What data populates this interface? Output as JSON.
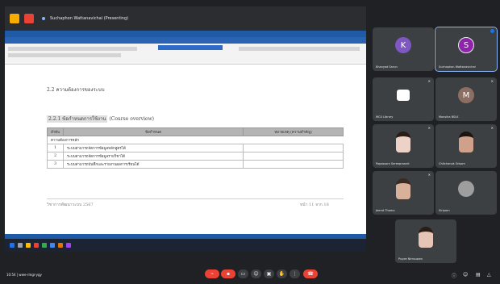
{
  "share": {
    "title_bar": "Suchaphon Wattanavichai (Presenting)",
    "doc": {
      "heading_22": "2.2 ความต้องการของระบบ",
      "heading_221": "2.2.1 ข้อกำหนดการใช้งาน",
      "heading_221_en": "(Course overview)",
      "table": {
        "headers": [
          "ลำดับ",
          "ข้อกำหนด",
          "หมายเหตุ (ความสำคัญ)"
        ],
        "group": "ความต้องการหลัก",
        "rows": [
          {
            "no": "1",
            "desc": "ระบบสามารถจัดการข้อมูลหลักสูตรได้"
          },
          {
            "no": "2",
            "desc": "ระบบสามารถจัดการข้อมูลรายวิชาได้"
          },
          {
            "no": "3",
            "desc": "ระบบสามารถบันทึกและรายงานผลการเรียนได้"
          }
        ]
      },
      "footer_left": "วิชาการพัฒนาระบบ 2567",
      "footer_right": "หน้า 11 จาก 18"
    }
  },
  "participants": [
    {
      "name": "Khanyad Sarun",
      "initial": "K",
      "avatar_color": "#7e57c2"
    },
    {
      "name": "Suchaphon Wattanavichai",
      "initial": "S",
      "avatar_color": "#8e24aa"
    },
    {
      "name": "MCU Library",
      "initial": "",
      "avatar_color": "#ffffff"
    },
    {
      "name": "Monsiha BSLK",
      "initial": "M",
      "avatar_color": "#8d6e63"
    },
    {
      "name": "Papassorn Sereeprasert",
      "initial": "",
      "avatar_color": "#ecd2c7"
    },
    {
      "name": "Chitchanok Srisom",
      "initial": "",
      "avatar_color": "#cfa18a"
    },
    {
      "name": "Jeerat Thamo",
      "initial": "",
      "avatar_color": "#d8b19b"
    },
    {
      "name": "Siriporn",
      "initial": "",
      "avatar_color": "#9e9e9e"
    },
    {
      "name": "Puyee Nimsuwan",
      "initial": "",
      "avatar_color": "#e6c4b6"
    }
  ],
  "meeting": {
    "info": "10:54 | wwe-rmgr-ygy"
  }
}
